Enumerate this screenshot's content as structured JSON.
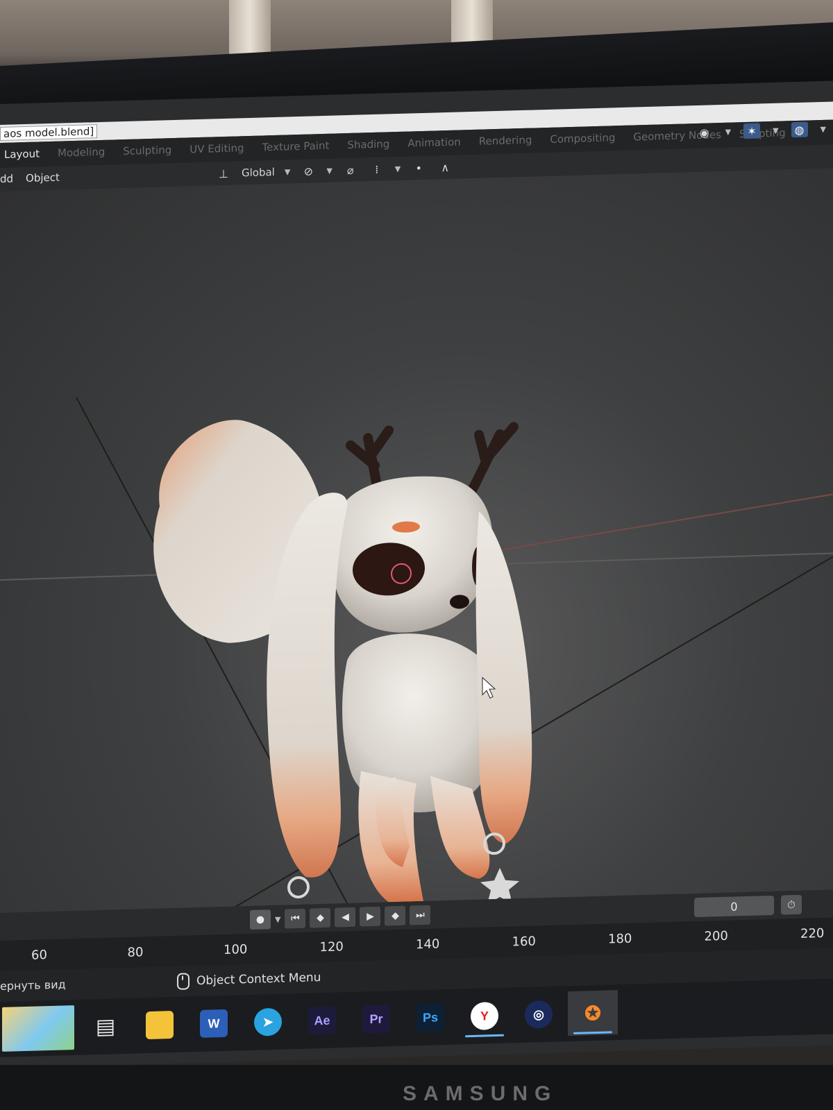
{
  "window": {
    "title": "aos model.blend]"
  },
  "workspace_tabs": [
    "Layout",
    "Modeling",
    "Sculpting",
    "UV Editing",
    "Texture Paint",
    "Shading",
    "Animation",
    "Rendering",
    "Compositing",
    "Geometry Nodes",
    "Scripting"
  ],
  "active_tab": "Layout",
  "header": {
    "menu": [
      "dd",
      "Object"
    ],
    "transform_orientation": "Global"
  },
  "timeline": {
    "current_frame": "0",
    "ruler_ticks": [
      "60",
      "80",
      "100",
      "120",
      "140",
      "160",
      "180",
      "200",
      "220"
    ]
  },
  "status": {
    "left": "ернуть вид",
    "context": "Object Context Menu"
  },
  "taskbar": {
    "apps": [
      {
        "name": "Word",
        "label": "W",
        "bg": "#2b5fb8",
        "fg": "#ffffff"
      },
      {
        "name": "Telegram",
        "label": "➤",
        "bg": "#2aa3e0",
        "fg": "#ffffff"
      },
      {
        "name": "After Effects",
        "label": "Ae",
        "bg": "#1d1b3a",
        "fg": "#a9a0ff"
      },
      {
        "name": "Premiere Pro",
        "label": "Pr",
        "bg": "#1f1a3c",
        "fg": "#b6a3ff"
      },
      {
        "name": "Photoshop",
        "label": "Ps",
        "bg": "#0d2035",
        "fg": "#3ea8ff"
      },
      {
        "name": "Yandex Browser",
        "label": "Y",
        "bg": "#ffffff",
        "fg": "#e21f1f"
      }
    ]
  },
  "colors": {
    "accent": "#3d5a8c",
    "taskbar_underline": "#6ab8ff"
  },
  "brand": "SAMSUNG"
}
